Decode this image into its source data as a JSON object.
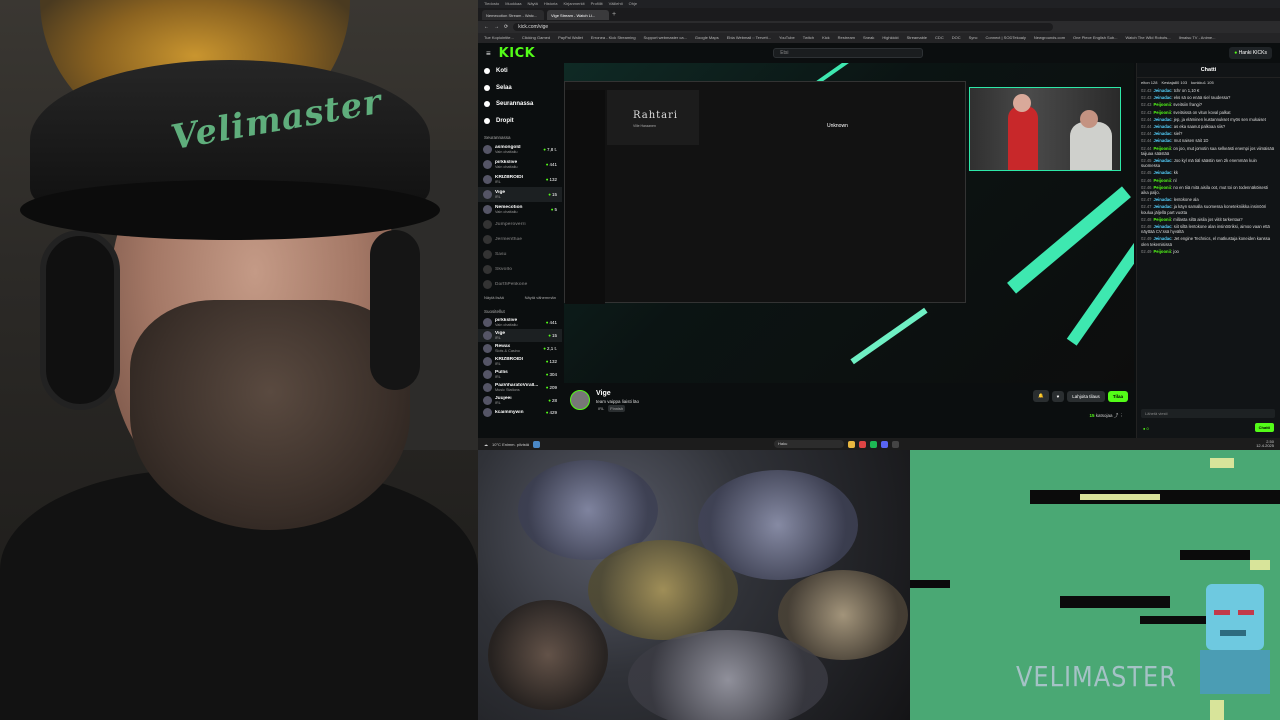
{
  "browser": {
    "menu": [
      "Tiedosto",
      "Muokkaa",
      "Näytä",
      "Historia",
      "Kirjanmerkit",
      "Profiilit",
      "Välilehti",
      "Ohje"
    ],
    "tabs": [
      {
        "label": "Nemecotion Stream - Watc...",
        "active": false
      },
      {
        "label": "Vige Stream - Watch Li...",
        "active": true
      }
    ],
    "url": "kick.com/vige",
    "bookmarks": [
      "Tue Kopiointite...",
      "Clicking Gamed",
      "PayPal Wallet",
      "Erronea - Kick Streaming",
      "Support webmaster ca...",
      "Google Maps",
      "Ebia Webmail :: Tervett...",
      "YouTube",
      "Twitch",
      "Kick",
      "Restream",
      "Sneak",
      "Highkickt",
      "Streamable",
      "CDC",
      "DOC",
      "Sync",
      "Connect | SODTekoaly",
      "Newgrounds.com",
      "One Piece English Sub...",
      "Watch The Wild Robots...",
      "Ilmaisu TV - Anime..."
    ]
  },
  "kick": {
    "logo": "KICK",
    "search_placeholder": "Etsi",
    "login_label": "Hanki KICKs",
    "nav": [
      {
        "label": "Koti"
      },
      {
        "label": "Selaa"
      },
      {
        "label": "Seurannassa"
      },
      {
        "label": "Dropit"
      }
    ],
    "following_title": "Seurannassa",
    "following": [
      {
        "name": "asmongold",
        "sub": "Vain chattailu",
        "viewers": "7,8 t.",
        "off": false
      },
      {
        "name": "pirkkslive",
        "sub": "Vain chattailu",
        "viewers": "441",
        "off": false
      },
      {
        "name": "KRIZBROIDI",
        "sub": "IRL",
        "viewers": "132",
        "off": false
      },
      {
        "name": "Vige",
        "sub": "IRL",
        "viewers": "15",
        "off": false
      },
      {
        "name": "Nemecotion",
        "sub": "Vain chattailu",
        "viewers": "5",
        "off": false
      },
      {
        "name": "Jumperoverri",
        "sub": "",
        "viewers": "",
        "off": true
      },
      {
        "name": "Jermenthae",
        "sub": "",
        "viewers": "",
        "off": true
      },
      {
        "name": "Sasu",
        "sub": "",
        "viewers": "",
        "off": true
      },
      {
        "name": "Skvollo",
        "sub": "",
        "viewers": "",
        "off": true
      },
      {
        "name": "DarthPelikone",
        "sub": "",
        "viewers": "",
        "off": true
      }
    ],
    "show_more": "Näytä lisää",
    "show_less": "Näytä vähemmän",
    "recommended_title": "Suositellut",
    "recommended": [
      {
        "name": "pirkkslive",
        "sub": "Vain chattailu",
        "viewers": "441"
      },
      {
        "name": "Vige",
        "sub": "IRL",
        "viewers": "15"
      },
      {
        "name": "Rewax",
        "sub": "Slots & Casino",
        "viewers": "2,1 t."
      },
      {
        "name": "KRIZBROIDI",
        "sub": "IRL",
        "viewers": "132"
      },
      {
        "name": "Pullis",
        "sub": "IRL",
        "viewers": "304"
      },
      {
        "name": "PaaViharatoVirall...",
        "sub": "Music Stations",
        "viewers": "209"
      },
      {
        "name": "Juujeei",
        "sub": "IRL",
        "viewers": "28"
      },
      {
        "name": "kcaimmywin",
        "sub": "",
        "viewers": "429"
      }
    ],
    "inner_stream_title": "Rahtari",
    "inner_stream_sub": "Ville Haraanen",
    "inner_unknown": "Unknown",
    "stream": {
      "name": "Vige",
      "title": "team vaippa liaisti läo",
      "category": "IRL",
      "tag": "Finnish",
      "subscribe_label": "Lahjoita tilaus",
      "follow_label": "Tilaa",
      "viewers": "15",
      "viewers_label": "katsojaa"
    },
    "chat": {
      "title": "Chatti",
      "top": [
        "elton 128",
        "Kestaja80 103",
        "kunkku1 105"
      ],
      "messages": [
        {
          "t": "02.43",
          "u": "Jeinadac",
          "m": "tchr on 1,10 €",
          "g": false
        },
        {
          "t": "02.43",
          "u": "Jeinadac",
          "m": "eks sä oo enää siel raudessa?",
          "g": false
        },
        {
          "t": "02.43",
          "u": "Peijoonii",
          "m": "sveitsiin frangi?",
          "g": true
        },
        {
          "t": "02.43",
          "u": "Peijoonii",
          "m": "sveitsissä on vitun koval palkat",
          "g": true
        },
        {
          "t": "02.44",
          "u": "Jeinadac",
          "m": "jep, ja eläminen kustannukset myös sen mukaiset",
          "g": false
        },
        {
          "t": "02.44",
          "u": "Jeinadac",
          "m": "as eka saanut palkoaa siis?",
          "g": false
        },
        {
          "t": "02.44",
          "u": "Jeinadac",
          "m": "siel?",
          "g": false
        },
        {
          "t": "02.44",
          "u": "Jeinadac",
          "m": "mut naisen säit 1D",
          "g": false
        },
        {
          "t": "02.44",
          "u": "Peijoonii",
          "m": "on joo, mut jomotin saa selkeästi enempi jos viimäisää taijuaa säästää",
          "g": true
        },
        {
          "t": "02.45",
          "u": "Jeinadac",
          "m": "Joo kyl mä tiäl säästin sen 2k enemmän kuin suomessa",
          "g": false
        },
        {
          "t": "02.45",
          "u": "Jeinadac",
          "m": "kk",
          "g": false
        },
        {
          "t": "02.46",
          "u": "Peijoonii",
          "m": "nl",
          "g": true
        },
        {
          "t": "02.46",
          "u": "Peijoonii",
          "m": "no en tiiä mitä aisila oot, mut toi on todennäköisesti aika paljo.",
          "g": true
        },
        {
          "t": "02.47",
          "u": "Jeinadac",
          "m": "lentokone ala",
          "g": false
        },
        {
          "t": "02.47",
          "u": "Jeinadac",
          "m": "ja käyn samalla suomessa konetekniikka insinööri koulua jäljellä part vuotta",
          "g": false
        },
        {
          "t": "02.48",
          "u": "Peijoonii",
          "m": "millasta siltä aisila jos viitit tarkentaa?",
          "g": true
        },
        {
          "t": "02.48",
          "u": "Jeinadac",
          "m": "siit siltä lentokone alan insinööriksi, aimoo vaan että näyttää CV:ssä hyvältä",
          "g": false
        },
        {
          "t": "02.49",
          "u": "Jeinadac",
          "m": "Jet engine Technics, el matkustaja koneiden kanssa olen tekemisissä",
          "g": false
        },
        {
          "t": "02.49",
          "u": "Peijoonii",
          "m": "joo",
          "g": true
        }
      ],
      "input_placeholder": "Lähetä viesti",
      "send_label": "Chatti",
      "points": "0"
    }
  },
  "taskbar": {
    "weather_temp": "10°C",
    "weather_desc": "Enimm. pilvistä",
    "search_placeholder": "Haku",
    "time": "2.50",
    "date": "12.4.2025"
  },
  "overlay": {
    "webcam_cap_text": "Velimaster",
    "brand_text": "VELIMASTER"
  }
}
